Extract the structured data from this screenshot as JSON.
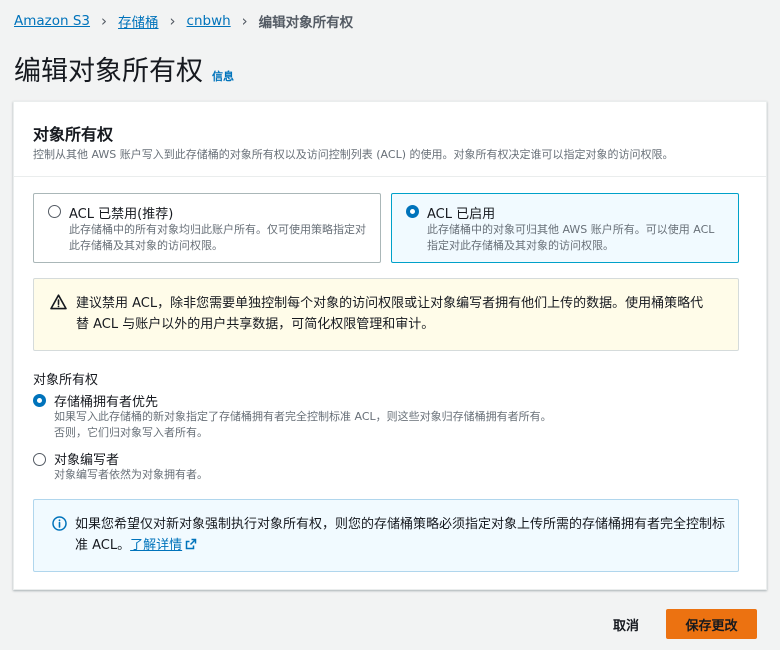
{
  "breadcrumb": {
    "items": [
      "Amazon S3",
      "存储桶",
      "cnbwh"
    ],
    "current": "编辑对象所有权"
  },
  "page": {
    "title": "编辑对象所有权",
    "info_link": "信息"
  },
  "panel": {
    "title": "对象所有权",
    "description": "控制从其他 AWS 账户写入到此存储桶的对象所有权以及访问控制列表 (ACL) 的使用。对象所有权决定谁可以指定对象的访问权限。"
  },
  "acl_tiles": [
    {
      "label": "ACL 已禁用(推荐)",
      "description": "此存储桶中的所有对象均归此账户所有。仅可使用策略指定对此存储桶及其对象的访问权限。",
      "selected": false
    },
    {
      "label": "ACL 已启用",
      "description": "此存储桶中的对象可归其他 AWS 账户所有。可以使用 ACL 指定对此存储桶及其对象的访问权限。",
      "selected": true
    }
  ],
  "warning": {
    "text": "建议禁用 ACL，除非您需要单独控制每个对象的访问权限或让对象编写者拥有他们上传的数据。使用桶策略代替 ACL 与账户以外的用户共享数据，可简化权限管理和审计。"
  },
  "ownership": {
    "label": "对象所有权",
    "options": [
      {
        "label": "存储桶拥有者优先",
        "description_lines": [
          "如果写入此存储桶的新对象指定了存储桶拥有者完全控制标准 ACL，则这些对象归存储桶拥有者所有。",
          "否则，它们归对象写入者所有。"
        ],
        "selected": true
      },
      {
        "label": "对象编写者",
        "description_lines": [
          "对象编写者依然为对象拥有者。"
        ],
        "selected": false
      }
    ]
  },
  "info_box": {
    "text": "如果您希望仅对新对象强制执行对象所有权，则您的存储桶策略必须指定对象上传所需的存储桶拥有者完全控制标准 ACL。",
    "learn_more": "了解详情"
  },
  "actions": {
    "cancel": "取消",
    "save": "保存更改"
  },
  "colors": {
    "link": "#0073bb",
    "primary_button": "#ec7211",
    "selected_border": "#00a1c9",
    "warning_bg": "#fffce9",
    "info_bg": "#f1faff"
  },
  "icons": {
    "breadcrumb_separator": "chevron-right-icon",
    "warning": "warning-triangle-icon",
    "info": "info-circle-icon",
    "external_link": "external-link-icon"
  }
}
